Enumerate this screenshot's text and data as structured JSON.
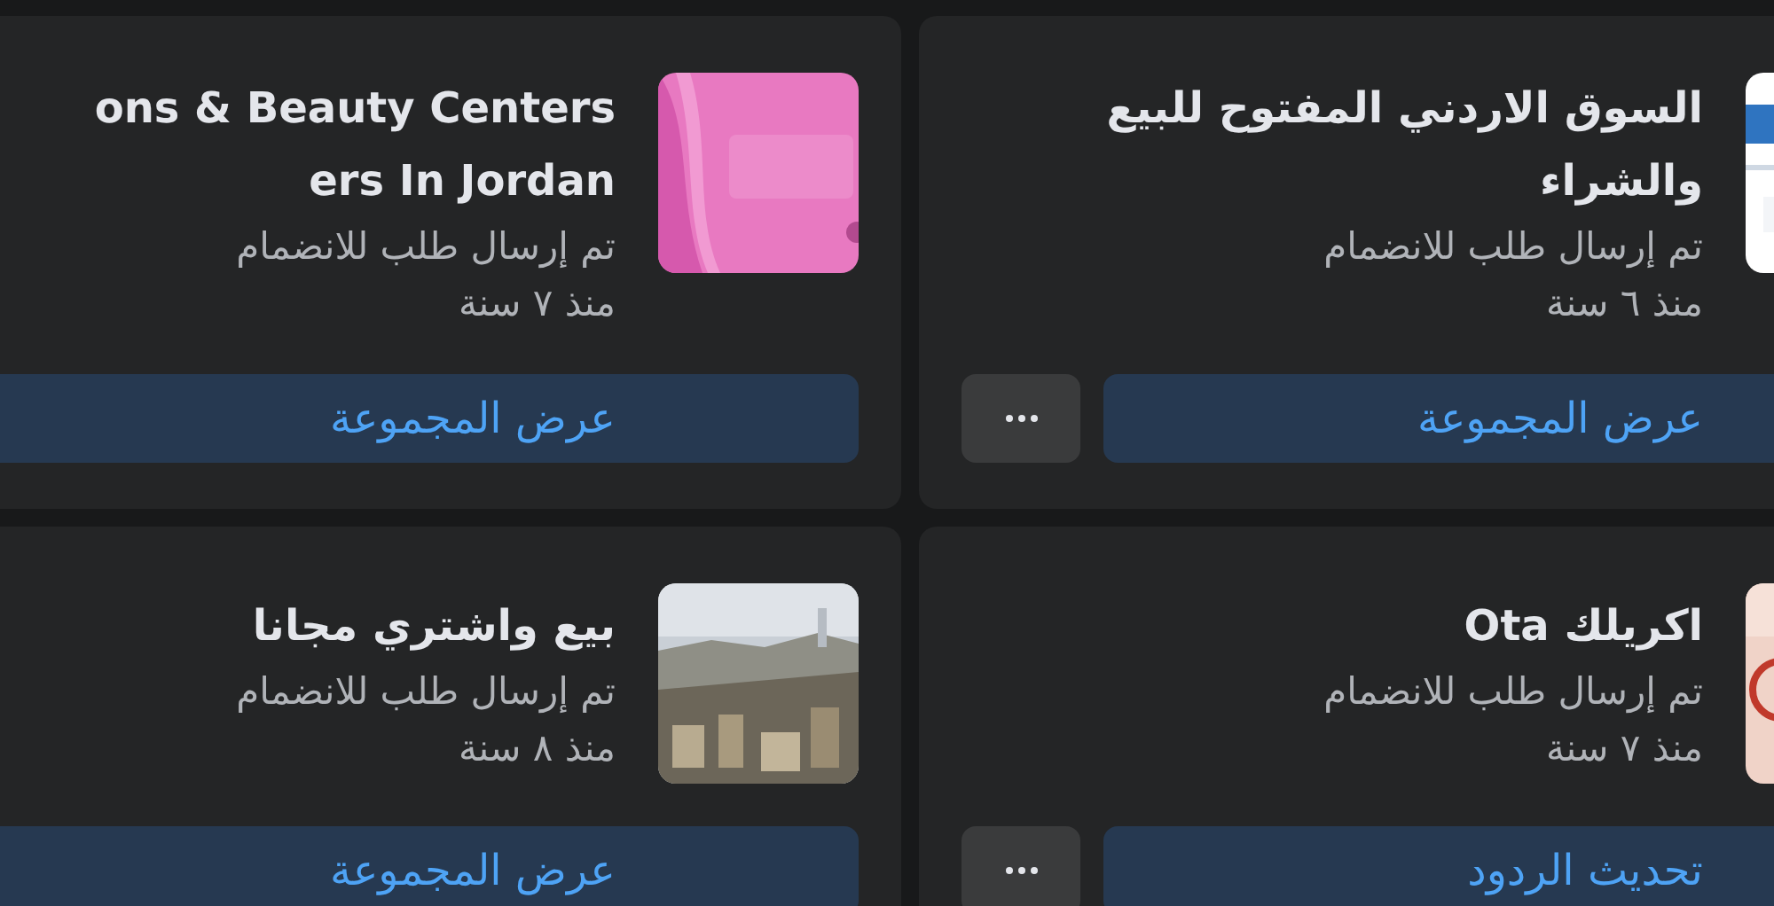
{
  "groups": [
    {
      "title_lines": [
        "السوق الاردني المفتوح للبيع",
        "والشراء"
      ],
      "status": "تم إرسال طلب للانضمام",
      "time": "منذ ٦ سنة",
      "action": "عرض المجموعة",
      "has_more": true
    },
    {
      "title_lines": [
        "ons & Beauty Centers",
        "ers In Jordan"
      ],
      "status": "تم إرسال طلب للانضمام",
      "time": "منذ ٧ سنة",
      "action": "عرض المجموعة",
      "has_more": false
    },
    {
      "title_lines": [
        "اكريلك Ota"
      ],
      "status": "تم إرسال طلب للانضمام",
      "time": "منذ ٧ سنة",
      "action": "تحديث الردود",
      "has_more": true
    },
    {
      "title_lines": [
        "بيع واشتري مجانا"
      ],
      "status": "تم إرسال طلب للانضمام",
      "time": "منذ ٨ سنة",
      "action": "عرض المجموعة",
      "has_more": false
    }
  ]
}
